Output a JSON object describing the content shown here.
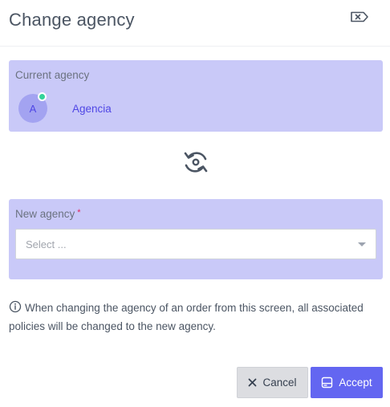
{
  "dialog": {
    "title": "Change agency"
  },
  "current_agency": {
    "label": "Current agency",
    "avatar_initial": "A",
    "name": "Agencia",
    "status_color": "#34d399"
  },
  "new_agency": {
    "label": "New agency",
    "required_mark": "*",
    "select_placeholder": "Select ..."
  },
  "info": {
    "text": "When changing the agency of an order from this screen, all associated policies will be changed to the new agency."
  },
  "buttons": {
    "cancel_label": "Cancel",
    "accept_label": "Accept"
  },
  "icons": {
    "close": "close-tag-icon",
    "swap": "rotate-swap-icon",
    "info": "info-circle-icon",
    "cancel": "x-icon",
    "accept": "save-disk-icon"
  },
  "colors": {
    "panel_bg": "#c9c9f8",
    "accent": "#6366f1",
    "link": "#4f46e5",
    "required": "#e0245e"
  }
}
